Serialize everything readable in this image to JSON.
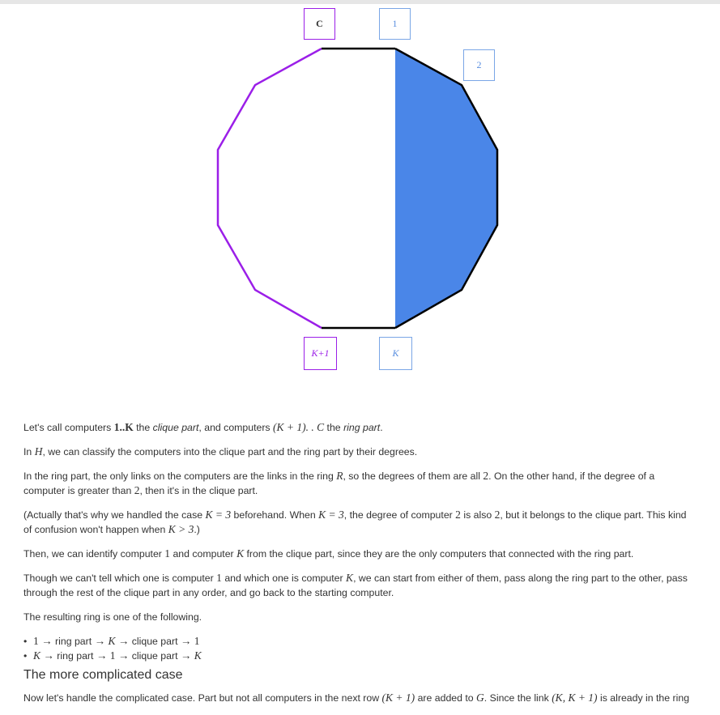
{
  "diagram": {
    "labels": {
      "c": "C",
      "one": "1",
      "two": "2",
      "k_plus_1": "K+1",
      "k": "K"
    },
    "colors": {
      "ring": "#9b1fe8",
      "clique_fill": "#4a86e8",
      "clique_edge": "#000000",
      "box_blue": "#7aa6e6"
    }
  },
  "text": {
    "p1": {
      "a": "Let's call computers ",
      "m1": "1..K",
      "b": " the ",
      "e1": "clique part",
      "c": ", and computers ",
      "m2": "(K + 1). . C",
      "d": " the ",
      "e2": "ring part",
      "f": "."
    },
    "p2": {
      "a": "In ",
      "m1": "H",
      "b": ", we can classify the computers into the clique part and the ring part by their degrees."
    },
    "p3": {
      "a": "In the ring part, the only links on the computers are the links in the ring ",
      "m1": "R",
      "b": ", so the degrees of them are all ",
      "m2": "2",
      "c": ". On the other hand, if the degree of a computer is greater than ",
      "m3": "2",
      "d": ", then it's in the clique part."
    },
    "p4": {
      "a": "(Actually that's why we handled the case ",
      "m1": "K = 3",
      "b": " beforehand. When ",
      "m2": "K = 3",
      "c": ", the degree of computer ",
      "m3": "2",
      "d": " is also ",
      "m4": "2",
      "e": ", but it belongs to the clique part. This kind of confusion won't happen when ",
      "m5": "K > 3",
      "f": ".)"
    },
    "p5": {
      "a": "Then, we can identify computer ",
      "m1": "1",
      "b": " and computer ",
      "m2": "K",
      "c": " from the clique part, since they are the only computers that connected with the ring part."
    },
    "p6": {
      "a": "Though we can't tell which one is computer ",
      "m1": "1",
      "b": " and which one is computer ",
      "m2": "K",
      "c": ", we can start from either of them, pass along the ring part to the other, pass through the rest of the clique part in any order, and go back to the starting computer."
    },
    "p7": "The resulting ring is one of the following.",
    "li1": {
      "m1": "1 →",
      "a": " ring part ",
      "m2": "→ K →",
      "b": " clique part ",
      "m3": "→ 1"
    },
    "li2": {
      "m1": "K →",
      "a": " ring part ",
      "m2": "→ 1 →",
      "b": " clique part ",
      "m3": "→ K"
    },
    "heading": "The more complicated case",
    "p8": {
      "a": "Now let's handle the complicated case. Part but not all computers in the next row ",
      "m1": "(K + 1)",
      "b": " are added to ",
      "m2": "G",
      "c": ". Since the link ",
      "m3": "(K, K + 1)",
      "d": " is already in the ring"
    }
  }
}
